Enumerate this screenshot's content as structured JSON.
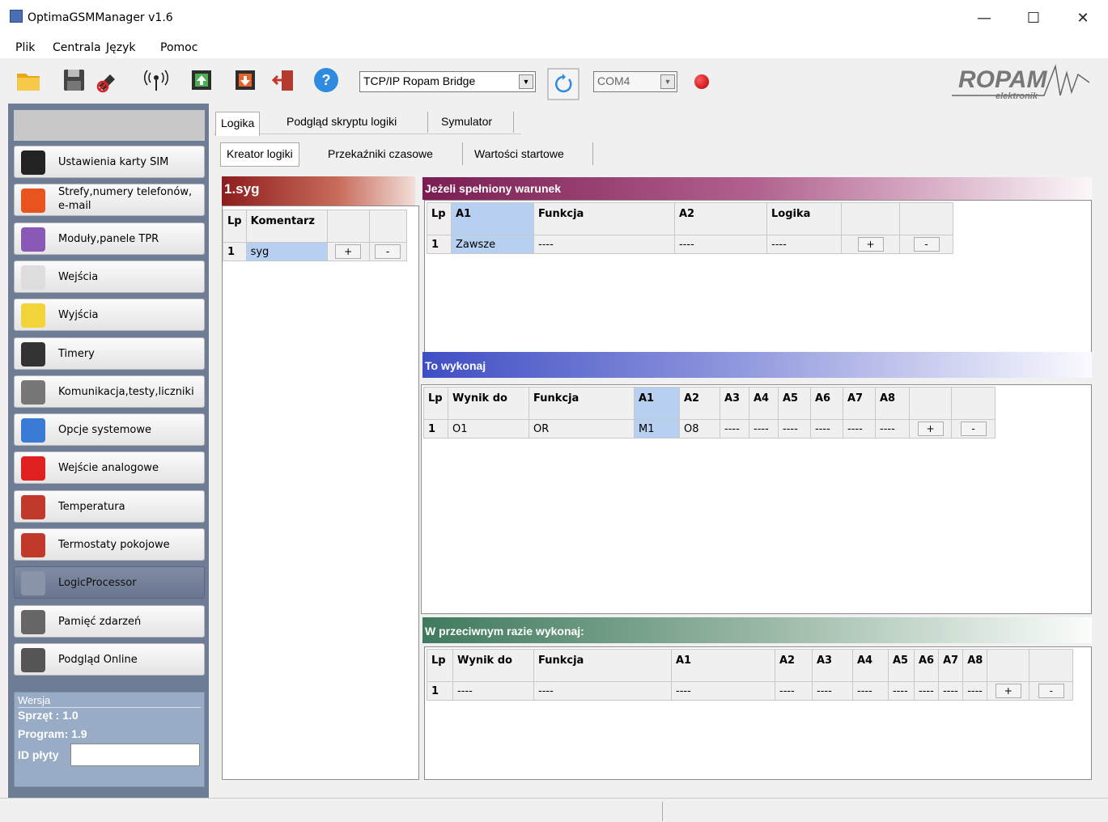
{
  "window": {
    "title": "OptimaGSMManager v1.6",
    "minimize": "—",
    "maximize": "☐",
    "close": "✕"
  },
  "menu": {
    "items": [
      "Plik",
      "Centrala",
      "Język",
      "Pomoc"
    ]
  },
  "toolbar": {
    "connection_type": "TCP/IP Ropam Bridge",
    "port": "COM4",
    "status_color": "#cc0000",
    "logo_text": "ROPAM",
    "logo_sub": "elektronik"
  },
  "sidebar": {
    "items": [
      {
        "label": "Ustawienia karty SIM",
        "icon": "sim-card-icon",
        "color": "#222"
      },
      {
        "label": "Strefy,numery telefonów,",
        "label2": "e-mail",
        "icon": "pie-chart-icon",
        "color": "#e8531e"
      },
      {
        "label": "Moduły,panele TPR",
        "icon": "cubes-icon",
        "color": "#8a59b5"
      },
      {
        "label": "Wejścia",
        "icon": "sensor-icon",
        "color": "#ddd"
      },
      {
        "label": "Wyjścia",
        "icon": "bulb-icon",
        "color": "#f2d338"
      },
      {
        "label": "Timery",
        "icon": "alarm-clock-icon",
        "color": "#333"
      },
      {
        "label": "Komunikacja,testy,liczniki",
        "icon": "tools-icon",
        "color": "#777"
      },
      {
        "label": "Opcje systemowe",
        "icon": "gears-icon",
        "color": "#3a7bd5"
      },
      {
        "label": "Wejście analogowe",
        "icon": "waveform-icon",
        "color": "#e02020"
      },
      {
        "label": "Temperatura",
        "icon": "thermometer-icon",
        "color": "#c0392b"
      },
      {
        "label": "Termostaty pokojowe",
        "icon": "thermostat-icon",
        "color": "#c0392b"
      },
      {
        "label": "LogicProcessor",
        "icon": "play-icon",
        "color": "#8a94a8"
      },
      {
        "label": "Pamięć zdarzeń",
        "icon": "magnifier-icon",
        "color": "#666"
      },
      {
        "label": "Podgląd Online",
        "icon": "monitor-icon",
        "color": "#555"
      }
    ],
    "active_index": 11,
    "version": {
      "legend": "Wersja",
      "hardware": "Sprzęt : 1.0",
      "program": "Program: 1.9",
      "board_id_label": "ID płyty",
      "board_id_value": ""
    }
  },
  "tabs": {
    "main": [
      "Logika",
      "Podgląd skryptu logiki",
      "Symulator"
    ],
    "sub": [
      "Kreator logiki",
      "Przekaźniki czasowe",
      "Wartości startowe"
    ]
  },
  "left_panel": {
    "title": "1.syg",
    "headers": [
      "Lp",
      "Komentarz"
    ],
    "rows": [
      {
        "lp": "1",
        "comment": "syg"
      }
    ],
    "plus": "+",
    "minus": "-"
  },
  "cond": {
    "title": "Jeżeli spełniony warunek",
    "headers": [
      "Lp",
      "A1",
      "Funkcja",
      "A2",
      "Logika"
    ],
    "rows": [
      {
        "lp": "1",
        "a1": "Zawsze",
        "fn": "----",
        "a2": "----",
        "logic": "----"
      }
    ],
    "plus": "+",
    "minus": "-"
  },
  "exec": {
    "title": "To wykonaj",
    "headers": [
      "Lp",
      "Wynik do",
      "Funkcja",
      "A1",
      "A2",
      "A3",
      "A4",
      "A5",
      "A6",
      "A7",
      "A8"
    ],
    "rows": [
      {
        "lp": "1",
        "out": "O1",
        "fn": "OR",
        "a1": "M1",
        "a2": "O8",
        "a3": "----",
        "a4": "----",
        "a5": "----",
        "a6": "----",
        "a7": "----",
        "a8": "----"
      }
    ],
    "plus": "+",
    "minus": "-"
  },
  "else": {
    "title": "W przeciwnym razie wykonaj:",
    "headers": [
      "Lp",
      "Wynik do",
      "Funkcja",
      "A1",
      "A2",
      "A3",
      "A4",
      "A5",
      "A6",
      "A7",
      "A8"
    ],
    "rows": [
      {
        "lp": "1",
        "out": "----",
        "fn": "----",
        "a1": "----",
        "a2": "----",
        "a3": "----",
        "a4": "----",
        "a5": "----",
        "a6": "----",
        "a7": "----",
        "a8": "----"
      }
    ],
    "plus": "+",
    "minus": "-"
  }
}
